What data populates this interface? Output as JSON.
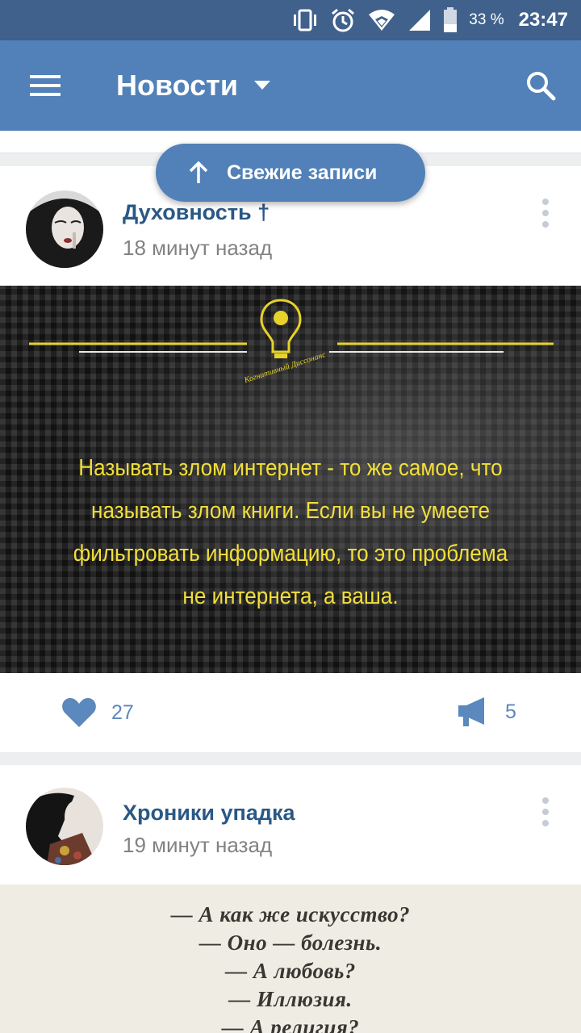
{
  "status_bar": {
    "battery_percent": "33 %",
    "time": "23:47",
    "icons": [
      "vibrate-icon",
      "alarm-icon",
      "wifi-icon",
      "signal-icon",
      "battery-icon"
    ]
  },
  "app_bar": {
    "title": "Новости",
    "icons": [
      "menu-icon",
      "dropdown-arrow-icon",
      "search-icon"
    ]
  },
  "fresh_button": {
    "label": "Свежие записи",
    "icon": "arrow-up-icon"
  },
  "posts": [
    {
      "author": "Духовность †",
      "time": "18 минут назад",
      "image_text": [
        "Называть злом интернет - то же самое, что",
        "называть злом книги. Если вы не умеете",
        "фильтровать информацию, то это проблема",
        "не интернета, а ваша."
      ],
      "image_logo_text": "Когнитивный Диссонанс",
      "likes": "27",
      "shares": "5",
      "colors": {
        "quote_text": "#f2df3a",
        "link": "#2a5885",
        "accent": "#5181b8"
      }
    },
    {
      "author": "Хроники упадка",
      "time": "19 минут назад",
      "image_text": [
        "— А как же искусство?",
        "— Оно — болезнь.",
        "— А любовь?",
        "— Иллюзия.",
        "— А религия?"
      ]
    }
  ]
}
